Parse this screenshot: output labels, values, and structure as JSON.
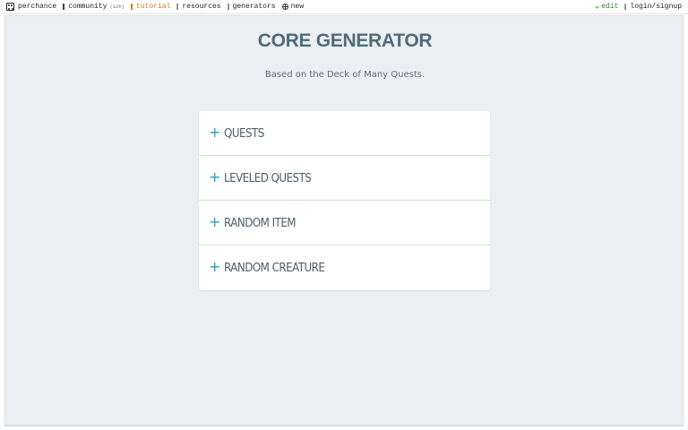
{
  "nav": {
    "brand": "perchance",
    "community": "community",
    "community_count": "(12h)",
    "tutorial": "tutorial",
    "resources": "resources",
    "generators": "generators",
    "new": "new",
    "edit": "edit",
    "login": "login/signup"
  },
  "header": {
    "title": "CORE GENERATOR",
    "subtitle": "Based on the Deck of Many Quests."
  },
  "accordion": {
    "items": [
      {
        "icon": "plus-icon",
        "label": "QUESTS"
      },
      {
        "icon": "plus-icon",
        "label": "LEVELED QUESTS"
      },
      {
        "icon": "plus-icon",
        "label": "RANDOM ITEM"
      },
      {
        "icon": "plus-icon",
        "label": "RANDOM CREATURE"
      }
    ]
  },
  "colors": {
    "accent": "#2ba0b4",
    "title": "#4e6b7b",
    "tutorial": "#e07a1c",
    "edit": "#2e8b2e",
    "background": "#ebeff2"
  }
}
